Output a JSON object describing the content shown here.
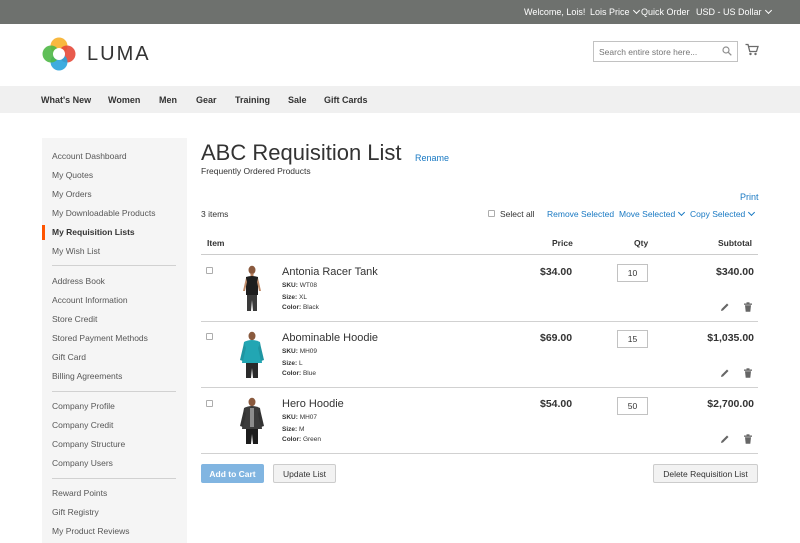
{
  "topbar": {
    "welcome": "Welcome, Lois!",
    "account": "Lois Price",
    "quick_order": "Quick Order",
    "currency": "USD - US Dollar"
  },
  "header": {
    "logo_text": "LUMA",
    "search_placeholder": "Search entire store here..."
  },
  "nav": {
    "items": [
      "What's New",
      "Women",
      "Men",
      "Gear",
      "Training",
      "Sale",
      "Gift Cards"
    ]
  },
  "sidebar": {
    "groups": [
      [
        "Account Dashboard",
        "My Quotes",
        "My Orders",
        "My Downloadable Products",
        "My Requisition Lists",
        "My Wish List"
      ],
      [
        "Address Book",
        "Account Information",
        "Store Credit",
        "Stored Payment Methods",
        "Gift Card",
        "Billing Agreements"
      ],
      [
        "Company Profile",
        "Company Credit",
        "Company Structure",
        "Company Users"
      ],
      [
        "Reward Points",
        "Gift Registry",
        "My Product Reviews"
      ]
    ],
    "active": "My Requisition Lists"
  },
  "main": {
    "title": "ABC Requisition List",
    "rename": "Rename",
    "subtitle": "Frequently Ordered Products",
    "print": "Print",
    "items_count": "3 items",
    "select_all": "Select all",
    "remove_selected": "Remove Selected",
    "move_selected": "Move Selected",
    "copy_selected": "Copy Selected",
    "columns": {
      "item": "Item",
      "price": "Price",
      "qty": "Qty",
      "subtotal": "Subtotal"
    },
    "products": [
      {
        "name": "Antonia Racer Tank",
        "sku_label": "SKU:",
        "sku": "WT08",
        "size_label": "Size:",
        "size": "XL",
        "color_label": "Color:",
        "color": "Black",
        "price": "$34.00",
        "qty": "10",
        "subtotal": "$340.00"
      },
      {
        "name": "Abominable Hoodie",
        "sku_label": "SKU:",
        "sku": "MH09",
        "size_label": "Size:",
        "size": "L",
        "color_label": "Color:",
        "color": "Blue",
        "price": "$69.00",
        "qty": "15",
        "subtotal": "$1,035.00"
      },
      {
        "name": "Hero Hoodie",
        "sku_label": "SKU:",
        "sku": "MH07",
        "size_label": "Size:",
        "size": "M",
        "color_label": "Color:",
        "color": "Green",
        "price": "$54.00",
        "qty": "50",
        "subtotal": "$2,700.00"
      }
    ],
    "buttons": {
      "add_to_cart": "Add to Cart",
      "update_list": "Update List",
      "delete_list": "Delete Requisition List"
    }
  },
  "colors": {
    "topbar": "#6e716e",
    "link": "#1979c3",
    "active_accent": "#ff5501",
    "primary_button": "#81b5e1"
  }
}
